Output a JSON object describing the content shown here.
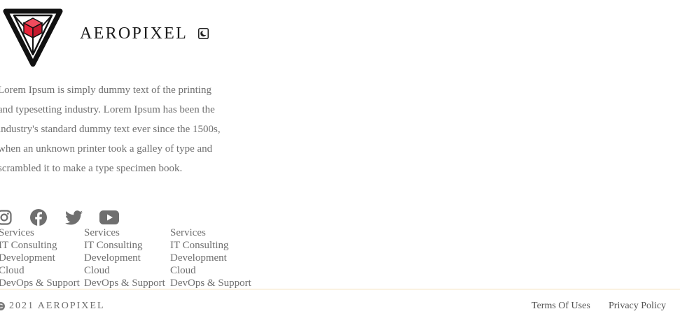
{
  "brand": {
    "name": "AEROPIXEL",
    "logo_icon": "triangle-cube-logo",
    "accent_color": "#e8253a"
  },
  "theme_toggle": {
    "icon": "moon-icon"
  },
  "about": {
    "text": "Lorem Ipsum is simply dummy text of the printing and typesetting industry. Lorem Ipsum has been the industry's standard dummy text ever since the 1500s, when an unknown printer took a galley of type and scrambled it to make a type specimen book."
  },
  "social": [
    {
      "icon": "instagram-icon"
    },
    {
      "icon": "facebook-icon"
    },
    {
      "icon": "twitter-icon"
    },
    {
      "icon": "youtube-icon"
    }
  ],
  "link_columns": [
    {
      "links": [
        "Services",
        "IT Consulting",
        "Development",
        "Cloud",
        "DevOps & Support"
      ]
    },
    {
      "links": [
        "Services",
        "IT Consulting",
        "Development",
        "Cloud",
        "DevOps & Support"
      ]
    },
    {
      "links": [
        "Services",
        "IT Consulting",
        "Development",
        "Cloud",
        "DevOps & Support"
      ]
    }
  ],
  "footer": {
    "copyright_icon": "copyright-icon",
    "copyright_text": "2021 AEROPIXEL",
    "terms_label": "Terms Of Uses",
    "privacy_label": "Privacy Policy",
    "divider_color": "#f3dfb8"
  }
}
